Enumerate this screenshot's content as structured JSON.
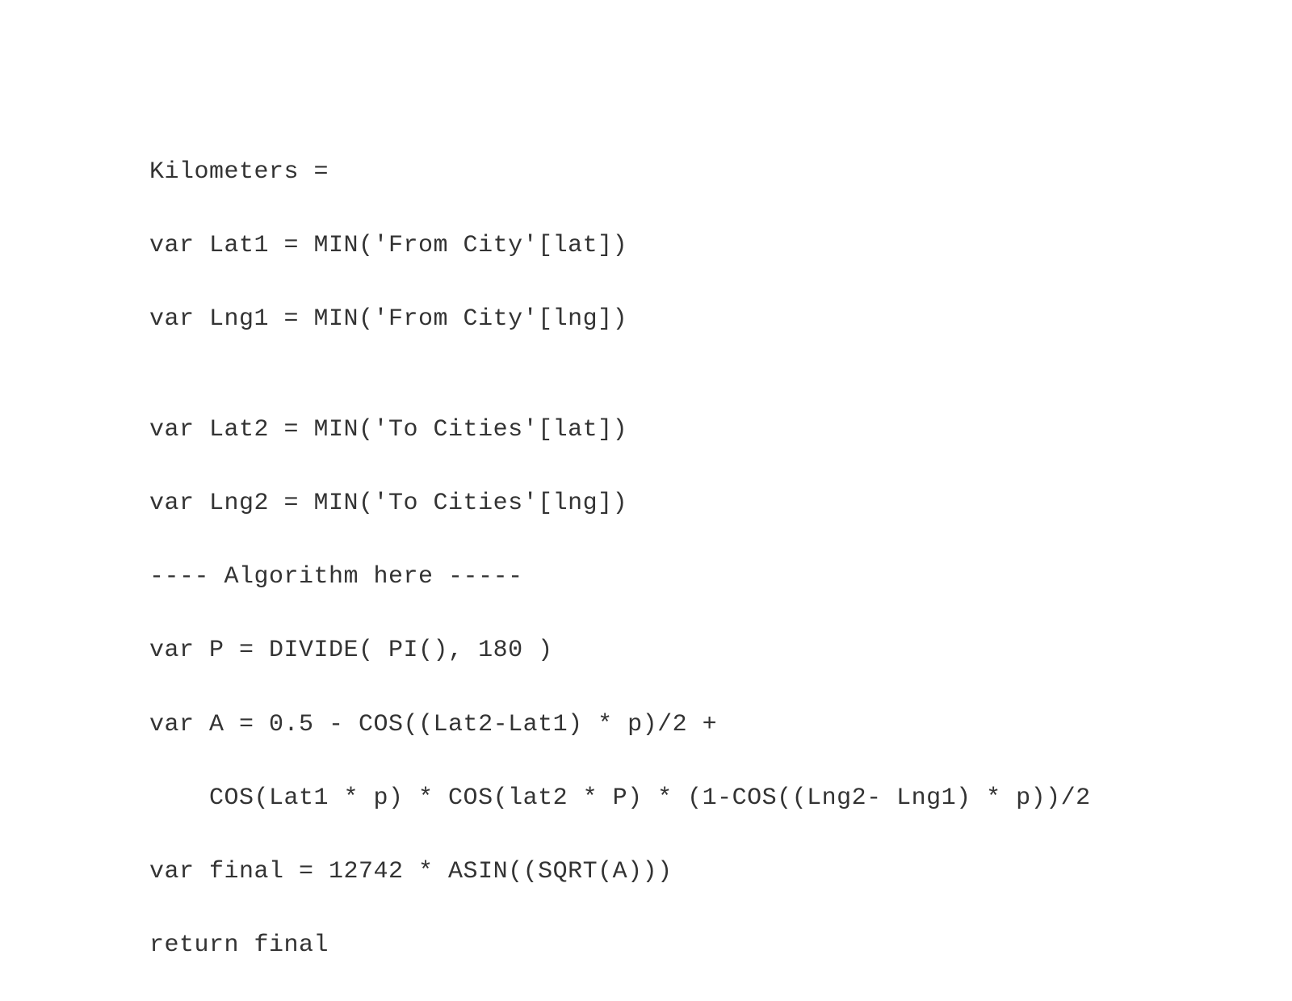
{
  "code": {
    "lines": [
      "Kilometers =",
      "var Lat1 = MIN('From City'[lat])",
      "var Lng1 = MIN('From City'[lng])",
      "",
      "var Lat2 = MIN('To Cities'[lat])",
      "var Lng2 = MIN('To Cities'[lng])",
      "---- Algorithm here -----",
      "var P = DIVIDE( PI(), 180 )",
      "var A = 0.5 - COS((Lat2-Lat1) * p)/2 +",
      "    COS(Lat1 * p) * COS(lat2 * P) * (1-COS((Lng2- Lng1) * p))/2",
      "var final = 12742 * ASIN((SQRT(A)))",
      "return final"
    ]
  }
}
